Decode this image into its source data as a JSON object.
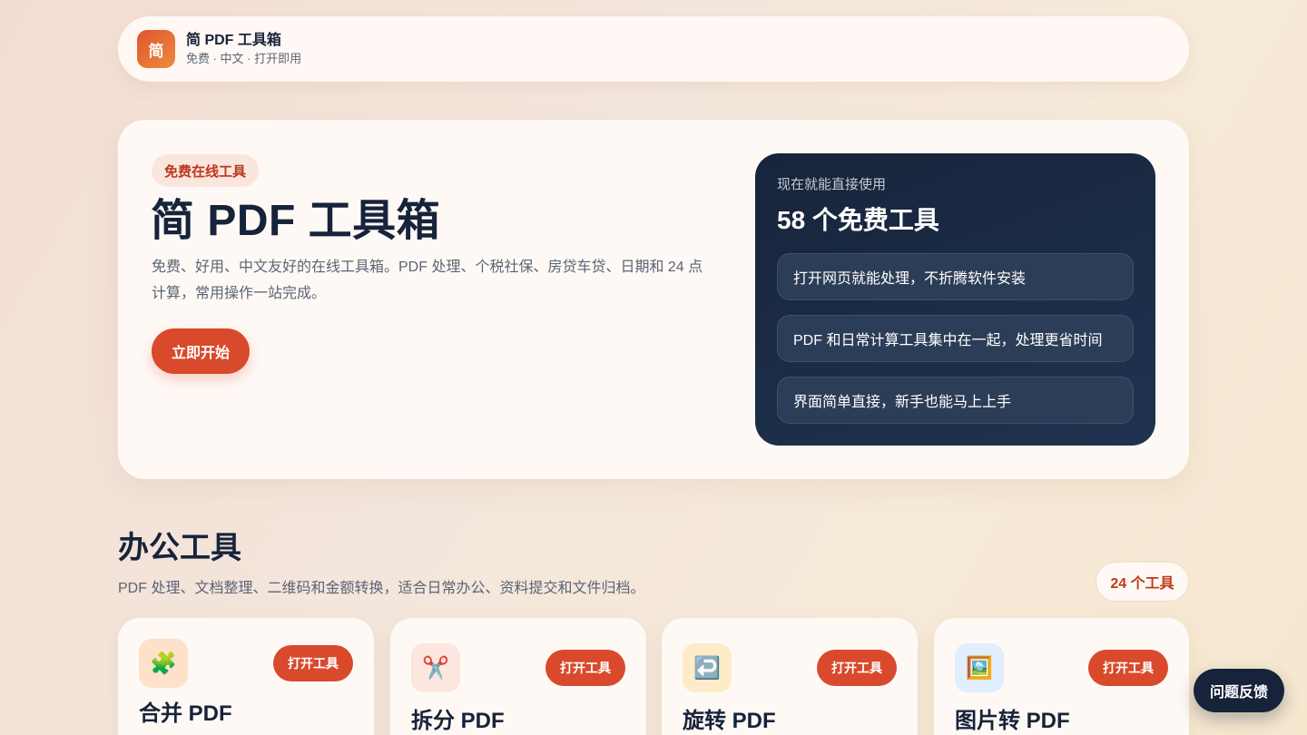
{
  "nav": {
    "logo_char": "简",
    "brand_name": "简 PDF 工具箱",
    "tagline": "免费 · 中文 · 打开即用"
  },
  "hero": {
    "badge": "免费在线工具",
    "title": "简 PDF 工具箱",
    "description": "免费、好用、中文友好的在线工具箱。PDF 处理、个税社保、房贷车贷、日期和 24 点计算，常用操作一站完成。",
    "cta_label": "立即开始",
    "panel": {
      "kicker": "现在就能直接使用",
      "count": "58 个免费工具",
      "items": [
        "打开网页就能处理，不折腾软件安装",
        "PDF 和日常计算工具集中在一起，处理更省时间",
        "界面简单直接，新手也能马上上手"
      ]
    }
  },
  "section": {
    "title": "办公工具",
    "description": "PDF 处理、文档整理、二维码和金额转换，适合日常办公、资料提交和文件归档。",
    "count": "24 个工具"
  },
  "tools": [
    {
      "name": "合并 PDF",
      "icon": "puzzle-icon",
      "glyph": "🧩",
      "icon_bg": "#fde1c9",
      "button": "打开工具"
    },
    {
      "name": "拆分 PDF",
      "icon": "scissors-icon",
      "glyph": "✂️",
      "icon_bg": "#fde6df",
      "button": "打开工具"
    },
    {
      "name": "旋转 PDF",
      "icon": "rotate-icon",
      "glyph": "↩️",
      "icon_bg": "#fdecc7",
      "button": "打开工具"
    },
    {
      "name": "图片转 PDF",
      "icon": "image-icon",
      "glyph": "🖼️",
      "icon_bg": "#e1eefd",
      "button": "打开工具"
    }
  ],
  "feedback_label": "问题反馈",
  "colors": {
    "accent": "#d9492c",
    "dark_panel": "#17233a",
    "badge_text": "#b9361c"
  }
}
